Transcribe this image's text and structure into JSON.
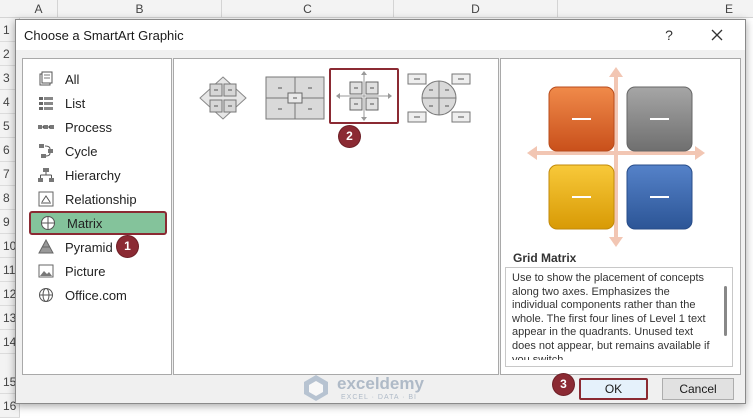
{
  "excel": {
    "columns": [
      "A",
      "B",
      "C",
      "D",
      "E"
    ],
    "rows": [
      "1",
      "2",
      "3",
      "4",
      "5",
      "6",
      "7",
      "8",
      "9",
      "10",
      "11",
      "12",
      "13",
      "14",
      "15",
      "16"
    ]
  },
  "dialog": {
    "title": "Choose a SmartArt Graphic",
    "help_label": "?",
    "categories": [
      {
        "label": "All",
        "icon": "all-icon"
      },
      {
        "label": "List",
        "icon": "list-icon"
      },
      {
        "label": "Process",
        "icon": "process-icon"
      },
      {
        "label": "Cycle",
        "icon": "cycle-icon"
      },
      {
        "label": "Hierarchy",
        "icon": "hierarchy-icon"
      },
      {
        "label": "Relationship",
        "icon": "relationship-icon"
      },
      {
        "label": "Matrix",
        "icon": "matrix-icon",
        "selected": true
      },
      {
        "label": "Pyramid",
        "icon": "pyramid-icon"
      },
      {
        "label": "Picture",
        "icon": "picture-icon"
      },
      {
        "label": "Office.com",
        "icon": "globe-icon"
      }
    ],
    "layouts": [
      "Basic Matrix",
      "Titled Matrix",
      "Grid Matrix",
      "Cycle Matrix"
    ],
    "selected_layout": "Grid Matrix",
    "preview": {
      "title": "Grid Matrix",
      "quadrant_text": "—",
      "colors": [
        "#ea6b2c",
        "#8e8e8e",
        "#f2b81c",
        "#3f6fb6"
      ],
      "description": "Use to show the placement of concepts along two axes. Emphasizes the individual components rather than the whole. The first four lines of Level 1 text appear in the quadrants. Unused text does not appear, but remains available if you switch"
    },
    "ok_label": "OK",
    "cancel_label": "Cancel"
  },
  "badges": [
    "1",
    "2",
    "3"
  ],
  "watermark": {
    "name": "exceldemy",
    "tagline": "EXCEL · DATA · BI"
  }
}
